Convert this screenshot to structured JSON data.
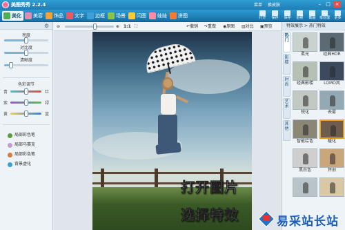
{
  "window": {
    "title": "美图秀秀 2.2.4",
    "links": [
      "菜单",
      "换皮肤"
    ],
    "controls": [
      "–",
      "□",
      "×"
    ]
  },
  "main_tabs": [
    {
      "label": "美化",
      "active": true,
      "icon": "brush-icon",
      "color": "#4caf50"
    },
    {
      "label": "美容",
      "active": false,
      "icon": "face-icon",
      "color": "#e58ab0"
    },
    {
      "label": "饰品",
      "active": false,
      "icon": "ribbon-icon",
      "color": "#f0a23b"
    },
    {
      "label": "文字",
      "active": false,
      "icon": "text-icon",
      "color": "#e65c5c"
    },
    {
      "label": "边框",
      "active": false,
      "icon": "frame-icon",
      "color": "#3fa0d9"
    },
    {
      "label": "场景",
      "active": false,
      "icon": "scene-icon",
      "color": "#8bc34a"
    },
    {
      "label": "闪图",
      "active": false,
      "icon": "flash-icon",
      "color": "#ffcc33"
    },
    {
      "label": "娃娃",
      "active": false,
      "icon": "doll-icon",
      "color": "#ff8aa8"
    },
    {
      "label": "拼图",
      "active": false,
      "icon": "collage-icon",
      "color": "#f27b3a"
    }
  ],
  "toolbar_buttons": [
    {
      "label": "打开",
      "icon": "open-icon"
    },
    {
      "label": "保存",
      "icon": "save-icon"
    },
    {
      "label": "保存",
      "icon": "save-as-icon"
    },
    {
      "label": "拍照",
      "icon": "camera-icon"
    },
    {
      "label": "截图",
      "icon": "screenshot-icon"
    },
    {
      "label": "批处理",
      "icon": "batch-icon"
    },
    {
      "label": "更多",
      "icon": "more-icon"
    }
  ],
  "left_panel": {
    "sliders": [
      {
        "label": "亮度",
        "value": 0.5
      },
      {
        "label": "对比度",
        "value": 0.5
      },
      {
        "label": "清晰度",
        "value": 0.15
      }
    ],
    "color_title": "色彩调节",
    "color_sliders": [
      {
        "left": "青",
        "right": "红",
        "value": 0.5,
        "gradient": "linear-gradient(90deg,#37c6c6,#e84a4a)"
      },
      {
        "left": "紫",
        "right": "绿",
        "value": 0.5,
        "gradient": "linear-gradient(90deg,#b04ad6,#4ac45a)"
      },
      {
        "left": "黄",
        "right": "蓝",
        "value": 0.5,
        "gradient": "linear-gradient(90deg,#e8d23a,#3a7de8)"
      }
    ],
    "tools": [
      {
        "label": "局部彩色笔",
        "color": "#5a9e3a"
      },
      {
        "label": "局部马赛克",
        "color": "#c49bd6"
      },
      {
        "label": "局部彩色笔",
        "color": "#e07a3a"
      },
      {
        "label": "背景虚化",
        "color": "#3aa0d6"
      }
    ]
  },
  "canvas_toolbar": {
    "zoom_value": 0.62,
    "zoom_label": "1:1",
    "actions": [
      "撤销",
      "重做",
      "原图",
      "对比",
      "预览"
    ]
  },
  "overlay_text": [
    "打开图片",
    "选择特效"
  ],
  "right_panel": {
    "header": "特效展示 > 热门特效",
    "tabs": [
      "热门",
      "影楼",
      "时尚",
      "艺术",
      "其他"
    ],
    "thumbnails": [
      {
        "label": "柔光",
        "bg": "#c9d2cc",
        "selected": false
      },
      {
        "label": "经典HDR",
        "bg": "#5c6a73",
        "selected": false
      },
      {
        "label": "经典影楼",
        "bg": "#b7c0b5",
        "selected": false
      },
      {
        "label": "LOMO风",
        "bg": "#3d4a5e",
        "selected": false
      },
      {
        "label": "锐化",
        "bg": "#c2c8c2",
        "selected": false
      },
      {
        "label": "去雾",
        "bg": "#93a9b3",
        "selected": false
      },
      {
        "label": "智能绘色",
        "bg": "#8c8674",
        "selected": false
      },
      {
        "label": "暖化",
        "bg": "#6e5d4e",
        "selected": true
      },
      {
        "label": "黑白色",
        "bg": "#cfcfcf",
        "selected": false
      },
      {
        "label": "怀旧",
        "bg": "#c9a77a",
        "selected": false
      },
      {
        "label": "",
        "bg": "#b9c4c8",
        "selected": false
      },
      {
        "label": "",
        "bg": "#d9c8a2",
        "selected": false
      }
    ]
  },
  "watermark": "易采站长站"
}
